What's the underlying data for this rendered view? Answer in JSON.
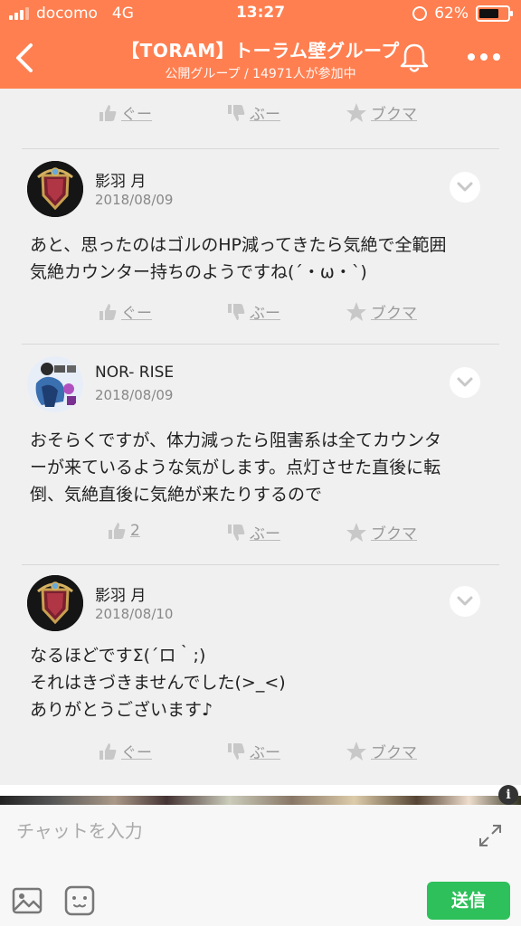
{
  "status": {
    "carrier": "docomo",
    "network": "4G",
    "time": "13:27",
    "battery": "62%",
    "battery_level": 0.62
  },
  "header": {
    "title": "【TORAM】トーラム壁グループ",
    "subtitle": "公開グループ / 14971人が参加中"
  },
  "reactions_labels": {
    "like": "ぐー",
    "dislike": "ぶー",
    "bookmark": "ブクマ"
  },
  "posts": [
    {
      "author": "影羽 月",
      "date": "2018/08/09",
      "body": "あと、思ったのはゴルのHP減ってきたら気絶で全範囲\n気絶カウンター持ちのようですね(´・ω・`)",
      "like": "ぐー"
    },
    {
      "author": "NOR- RISE",
      "date": "2018/08/09",
      "body": "おそらくですが、体力減ったら阻害系は全てカウンタ\nーが来ているような気がします。点灯させた直後に転\n倒、気絶直後に気絶が来たりするので",
      "like": "2"
    },
    {
      "author": "影羽 月",
      "date": "2018/08/10",
      "body": "なるほどですΣ(´ロ｀;)\nそれはきづきませんでした(>_<)\nありがとうございます♪",
      "like": "ぐー"
    }
  ],
  "chat": {
    "placeholder": "チャットを入力",
    "send_label": "送信"
  },
  "ad": {
    "info_glyph": "i"
  },
  "colors": {
    "header": "#ff7f50",
    "send": "#2ec05a",
    "reaction": "#999999"
  }
}
